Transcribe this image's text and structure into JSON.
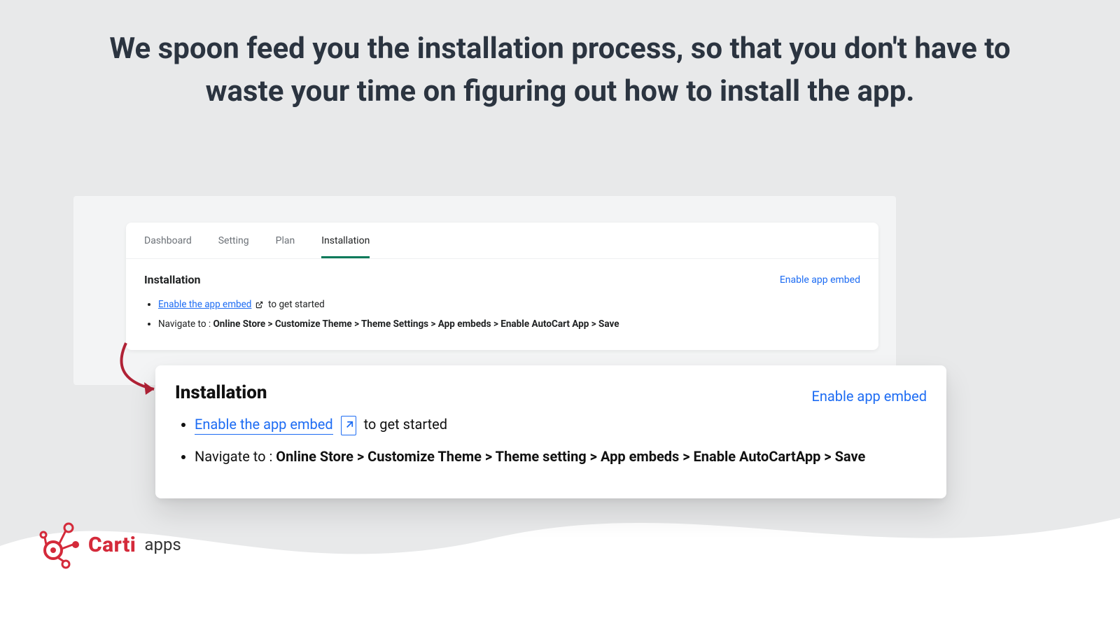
{
  "headline": "We spoon feed you the installation process, so that you don't have to waste your time on figuring out how to install the app.",
  "tabs": {
    "dashboard": "Dashboard",
    "setting": "Setting",
    "plan": "Plan",
    "installation": "Installation"
  },
  "card1": {
    "title": "Installation",
    "enable_link": "Enable app embed",
    "bullet1_link": "Enable the app embed",
    "bullet1_tail": "to get started",
    "bullet2_lead": "Navigate to : ",
    "bullet2_path": "Online Store > Customize Theme > Theme Settings > App embeds > Enable AutoCart App > Save"
  },
  "card2": {
    "title": "Installation",
    "enable_link": "Enable app embed",
    "bullet1_link": "Enable the app embed",
    "bullet1_tail": "to get started",
    "bullet2_lead": "Navigate to : ",
    "bullet2_path": "Online Store > Customize Theme > Theme setting > App embeds > Enable AutoCartApp > Save"
  },
  "brand": {
    "name": "Carti",
    "suffix": "apps"
  }
}
